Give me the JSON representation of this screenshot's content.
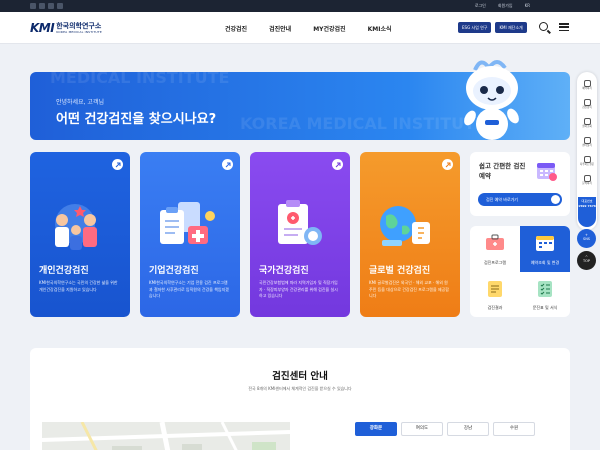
{
  "topbar": {
    "links": [
      "로그인",
      "회원가입",
      "KR"
    ],
    "sns_icons": [
      "naver-blog-icon",
      "facebook-icon",
      "youtube-icon",
      "instagram-icon"
    ]
  },
  "header": {
    "logo_kmi": "KMI",
    "logo_kr": "한국의학연구소",
    "logo_en": "KOREA MEDICAL INSTITUTE",
    "nav": [
      "건강검진",
      "검진안내",
      "MY건강검진",
      "KMI소식"
    ],
    "btn_esg": "ESG 사업 연구",
    "btn_foundation": "KMI 재단소개"
  },
  "hero": {
    "bg_text_1": "MEDICAL INSTITUTE",
    "bg_text_2": "KOREA MEDICAL INSTITUTE",
    "greeting": "안녕하세요, 고객님",
    "question": "어떤 건강검진을 찾으시나요?"
  },
  "cards": [
    {
      "title": "개인건강검진",
      "desc": "KMI한국의학연구소는 국민의 건강한 삶을 위한 개인건강검진을 지원하고 있습니다"
    },
    {
      "title": "기업건강검진",
      "desc": "KMI한국의학연구소는 기업 전용 검진 프로그램과 철저한 사후관리로 임직원의 건강을 책임지겠습니다"
    },
    {
      "title": "국가건강검진",
      "desc": "국민건강보험법에 따라 지역가입자 및 직장가입자 · 직장피부양자 건강관리를 위해 검진을 실시하고 있습니다"
    },
    {
      "title": "글로벌 건강검진",
      "desc": "KMI 글로벌검진은 외국인 · 해외 교포 · 해외 원주민 등을 대상으로 건강검진 프로그램을 제공합니다"
    }
  ],
  "reservation": {
    "title": "쉽고 간편한 검진예약",
    "button": "검진 예약 바로가기"
  },
  "quick_menu": [
    {
      "label": "검진프로그램",
      "icon": "medical-kit-icon"
    },
    {
      "label": "예약조회 및 변경",
      "icon": "calendar-icon"
    },
    {
      "label": "검진결과",
      "icon": "report-icon"
    },
    {
      "label": "문진표 및 서식",
      "icon": "checklist-icon"
    }
  ],
  "sidebar": {
    "items": [
      "예약하기",
      "검진항목",
      "결과조회",
      "센터찾기",
      "자주하는질문",
      "문의하기"
    ],
    "phone_label": "대표번호",
    "phone_number": "1599 7676",
    "sns_fab": "SNS",
    "top_fab": "TOP"
  },
  "center": {
    "title": "검진센터 안내",
    "subtitle": "전국 8개의 KMI센터에서 체계적인 검진을 받으실 수 있습니다",
    "tabs": [
      "광화문",
      "여의도",
      "강남",
      "수원"
    ],
    "active_tab": "광화문"
  },
  "colors": {
    "primary": "#1f5fd8",
    "navy": "#0d2a6b",
    "purple": "#7338de",
    "orange": "#ef7d16",
    "dark_bar": "#1c2433"
  }
}
